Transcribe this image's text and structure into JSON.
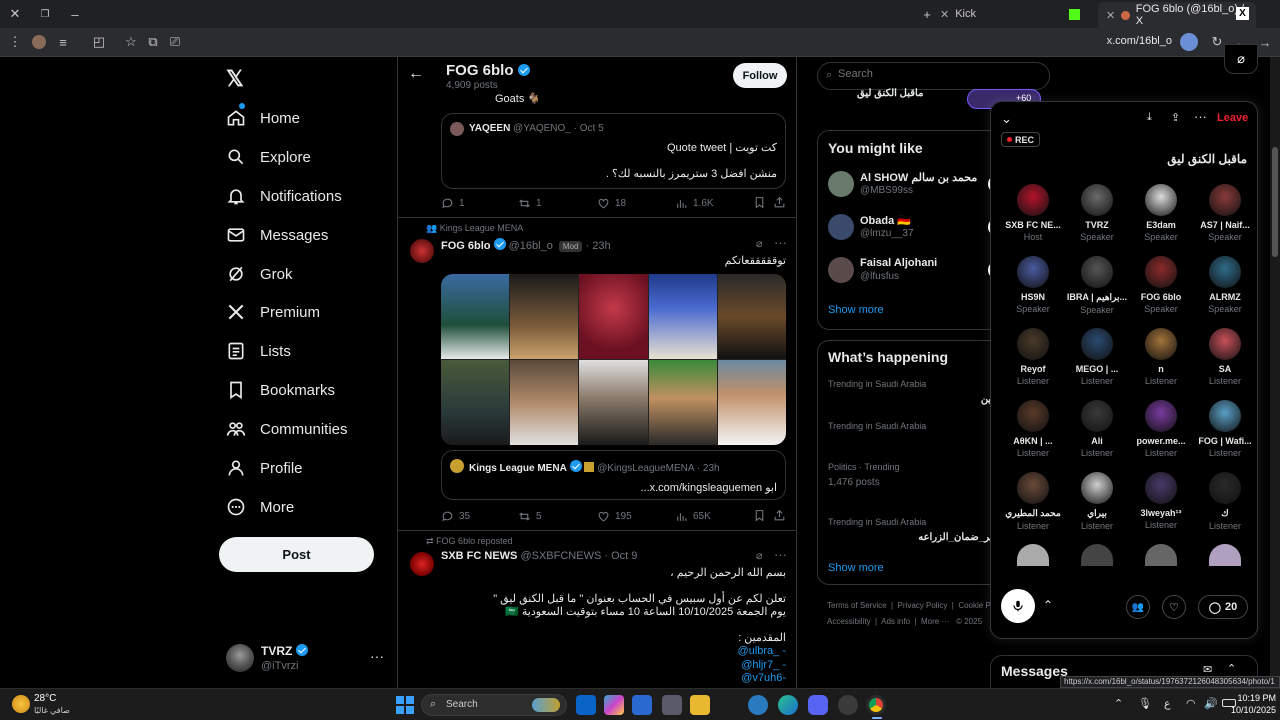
{
  "browser": {
    "tabs": [
      {
        "label": "Kick"
      },
      {
        "label": "FOG 6blo (@16bl_o) / X"
      }
    ],
    "address": "x.com/16bl_o",
    "status_url": "https://x.com/16bl_o/status/1976372126048305634/photo/1"
  },
  "nav": {
    "items": [
      {
        "label": "Home",
        "icon": "home-icon"
      },
      {
        "label": "Explore",
        "icon": "search-icon"
      },
      {
        "label": "Notifications",
        "icon": "bell-icon"
      },
      {
        "label": "Messages",
        "icon": "mail-icon"
      },
      {
        "label": "Grok",
        "icon": "grok-icon"
      },
      {
        "label": "Premium",
        "icon": "x-logo-icon"
      },
      {
        "label": "Lists",
        "icon": "list-icon"
      },
      {
        "label": "Bookmarks",
        "icon": "bookmark-icon"
      },
      {
        "label": "Communities",
        "icon": "people-icon"
      },
      {
        "label": "Profile",
        "icon": "person-icon"
      },
      {
        "label": "More",
        "icon": "more-circle-icon"
      }
    ],
    "post_label": "Post",
    "account": {
      "name": "TVRZ",
      "handle": "@iTvrzi"
    }
  },
  "header": {
    "name": "FOG 6blo",
    "posts": "4,909 posts",
    "follow": "Follow"
  },
  "feed": {
    "top_fragment": "Goats 🐐",
    "quote1": {
      "name": "YAQEEN",
      "handle": "@YAQENO_",
      "date": "· Oct 5",
      "line1": "كت تويت | Quote tweet",
      "line2": "منشن افضل 3 ستريمرز بالنسبه لك؟ ."
    },
    "stats1": {
      "replies": "1",
      "reposts": "1",
      "likes": "18",
      "views": "1.6K"
    },
    "tweet2": {
      "context": "Kings League MENA",
      "name": "FOG 6blo",
      "handle": "@16bl_o",
      "badge": "Mod",
      "time": "· 23h",
      "text": "توقققققعاتكم",
      "quote": {
        "name": "Kings League MENA",
        "handle": "@KingsLeagueMENA",
        "time": "· 23h",
        "text": "ابو x.com/kingsleaguemen..."
      },
      "stats": {
        "replies": "35",
        "reposts": "5",
        "likes": "195",
        "views": "65K"
      }
    },
    "tweet3": {
      "context": "FOG 6blo reposted",
      "name": "SXB FC NEWS",
      "handle": "@SXBFCNEWS",
      "time": "· Oct 9",
      "lines": [
        "بسم الله الرحمن الرحيم ،",
        "تعلن لكم عن أول سبيس في الحساب بعنوان \" ما قبل الكنق ليق \"",
        "يوم الجمعة 10/10/2025 الساعة 10 مساء بتوقيت السعودية 🇸🇦",
        "المقدمين :"
      ],
      "mentions": [
        "@ulbra_ -",
        "@hljr7_ -",
        "@v7uh6-"
      ]
    }
  },
  "search": {
    "placeholder": "Search"
  },
  "right": {
    "space_snippet": "ماقبل الكنق ليق",
    "space_count": "+60",
    "might_like_title": "You might like",
    "people": [
      {
        "name": "Al SHOW محمد بن سالم",
        "handle": "@MBS99ss"
      },
      {
        "name": "Obada 🇩🇪",
        "handle": "@lmzu__37"
      },
      {
        "name": "Faisal Aljohani",
        "handle": "@lfusfus"
      }
    ],
    "show_more": "Show more",
    "happening_title": "What’s happening",
    "trends": [
      {
        "meta": "Trending in Saudi Arabia",
        "topic": "ثلاثين"
      },
      {
        "meta": "Trending in Saudi Arabia",
        "topic": ""
      },
      {
        "meta": "Politics · Trending",
        "topic": "1,476 posts"
      },
      {
        "meta": "Trending in Saudi Arabia",
        "topic": "شعر_ضمان_الزراعه"
      }
    ],
    "footer": [
      "Terms of Service",
      "Privacy Policy",
      "Cookie P",
      "Accessibility",
      "Ads info",
      "More ···",
      "© 2025"
    ],
    "messages_title": "Messages"
  },
  "spaces": {
    "leave": "Leave",
    "rec": "REC",
    "title": "ماقبل الكنق ليق",
    "participants": [
      {
        "name": "SXB FC NE...",
        "role": "Host",
        "color": "#b3132b"
      },
      {
        "name": "TVRZ",
        "role": "Speaker",
        "color": "#6b6b6b"
      },
      {
        "name": "E3dam",
        "role": "Speaker",
        "color": "#ddd"
      },
      {
        "name": "AS7 | Naif...",
        "role": "Speaker",
        "color": "#8a3a3a"
      },
      {
        "name": "HS9N",
        "role": "Speaker",
        "color": "#4a5aa0"
      },
      {
        "name": "IBRA | براهيم...",
        "role": "Speaker",
        "color": "#555"
      },
      {
        "name": "FOG 6blo",
        "role": "Speaker",
        "color": "#8c2b2b"
      },
      {
        "name": "ALRMZ",
        "role": "Speaker",
        "color": "#2f6b8a"
      },
      {
        "name": "Reyof",
        "role": "Listener",
        "color": "#4a3a2a"
      },
      {
        "name": "MEGO | ...",
        "role": "Listener",
        "color": "#2a4a70"
      },
      {
        "name": "n",
        "role": "Listener",
        "color": "#a4733a"
      },
      {
        "name": "SA",
        "role": "Listener",
        "color": "#c8505a"
      },
      {
        "name": "AθKN | ...",
        "role": "Listener",
        "color": "#5a3a2a"
      },
      {
        "name": "Ali",
        "role": "Listener",
        "color": "#3a3a3a"
      },
      {
        "name": "power.me...",
        "role": "Listener",
        "color": "#7a3aa0"
      },
      {
        "name": "FOG | Wafi...",
        "role": "Listener",
        "color": "#5aa0c8"
      },
      {
        "name": "محمد المطيري",
        "role": "Listener",
        "color": "#6a4a3a"
      },
      {
        "name": "بيراي",
        "role": "Listener",
        "color": "#cfcfcf"
      },
      {
        "name": "3lweyah¹³",
        "role": "Listener",
        "color": "#4a3a6a"
      },
      {
        "name": "ك",
        "role": "Listener",
        "color": "#2a2a2a"
      }
    ],
    "reply_count": "20"
  },
  "taskbar": {
    "weather_temp": "28°C",
    "weather_desc": "صافي غالبًا",
    "search": "Search",
    "lang": "ع",
    "time": "10:19 PM",
    "date": "10/10/2025"
  },
  "colors": {
    "accent": "#1d9bf0",
    "leave": "#f4212e",
    "bg": "#000000"
  }
}
